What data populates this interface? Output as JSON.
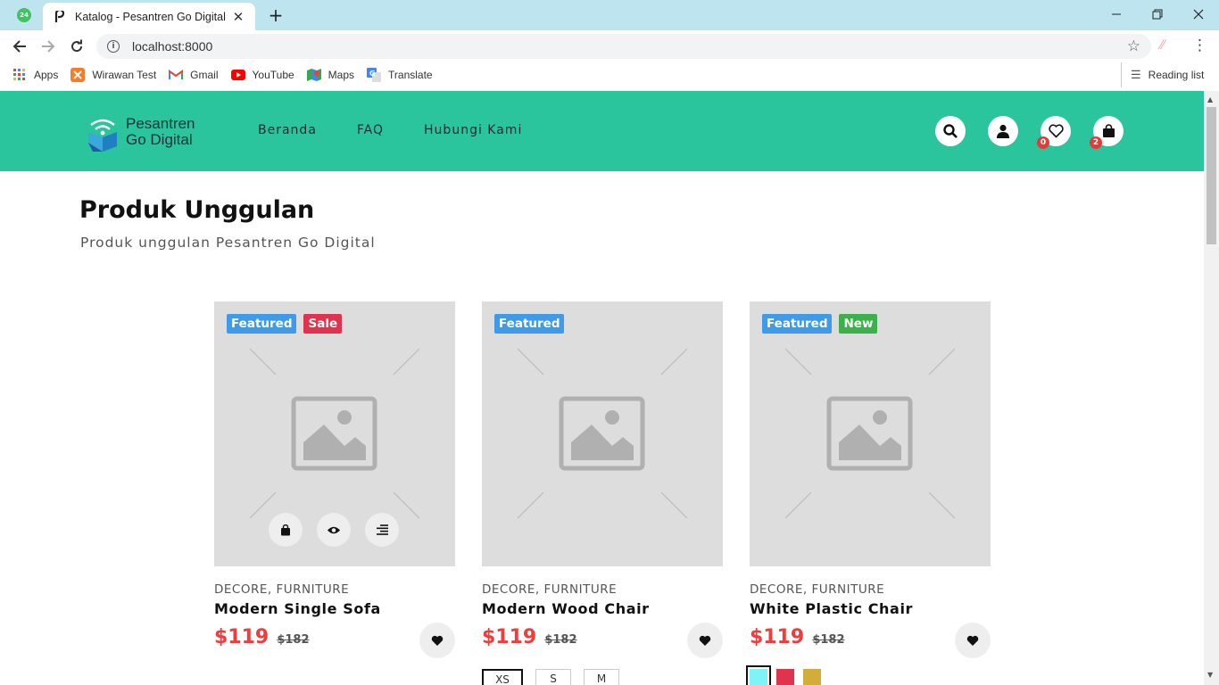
{
  "browser": {
    "pinned_tab_badge": "24",
    "tab_title": "Katalog - Pesantren Go Digital",
    "url": "localhost:8000",
    "bookmarks": [
      {
        "label": "Apps",
        "icon": "apps-grid-icon"
      },
      {
        "label": "Wirawan Test",
        "icon": "xampp-icon"
      },
      {
        "label": "Gmail",
        "icon": "gmail-icon"
      },
      {
        "label": "YouTube",
        "icon": "youtube-icon"
      },
      {
        "label": "Maps",
        "icon": "maps-icon"
      },
      {
        "label": "Translate",
        "icon": "translate-icon"
      }
    ],
    "reading_list": "Reading list"
  },
  "header": {
    "logo_line1": "Pesantren",
    "logo_line2": "Go Digital",
    "nav": [
      "Beranda",
      "FAQ",
      "Hubungi Kami"
    ],
    "wishlist_count": "0",
    "cart_count": "2",
    "brand_color": "#2ac59d"
  },
  "section": {
    "title": "Produk Unggulan",
    "subtitle": "Produk unggulan Pesantren Go Digital"
  },
  "products": [
    {
      "badges": [
        "Featured",
        "Sale"
      ],
      "category": "DECORE, FURNITURE",
      "name": "Modern Single Sofa",
      "price": "$119",
      "old_price": "$182"
    },
    {
      "badges": [
        "Featured"
      ],
      "category": "DECORE, FURNITURE",
      "name": "Modern Wood Chair",
      "price": "$119",
      "old_price": "$182",
      "sizes": [
        "XS",
        "S",
        "M"
      ],
      "selected_size": "XS"
    },
    {
      "badges": [
        "Featured",
        "New"
      ],
      "category": "DECORE, FURNITURE",
      "name": "White Plastic Chair",
      "price": "$119",
      "old_price": "$182",
      "colors": [
        "#7ff3f7",
        "#e0334d",
        "#d4ac3a"
      ],
      "selected_color": "#7ff3f7"
    }
  ]
}
